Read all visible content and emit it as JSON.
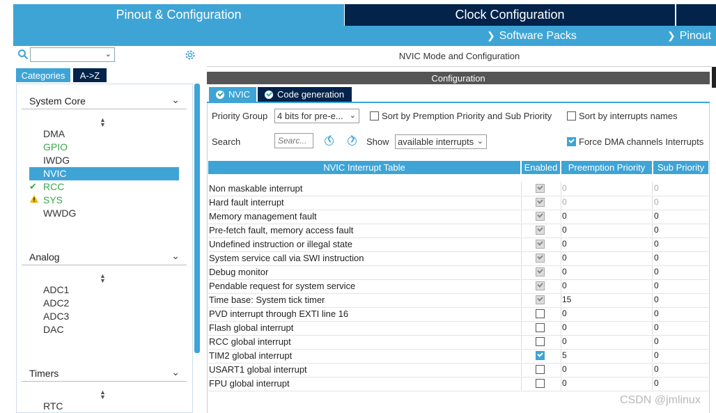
{
  "tabs": {
    "pinout": "Pinout & Configuration",
    "clock": "Clock Configuration"
  },
  "menubar": {
    "software_packs": "Software Packs",
    "pinout": "Pinout"
  },
  "left": {
    "categories_btn": "Categories",
    "az_btn": "A->Z",
    "sections": [
      {
        "label": "System Core",
        "items": [
          "DMA",
          "GPIO",
          "IWDG",
          "NVIC",
          "RCC",
          "SYS",
          "WWDG"
        ]
      },
      {
        "label": "Analog",
        "items": [
          "ADC1",
          "ADC2",
          "ADC3",
          "DAC"
        ]
      },
      {
        "label": "Timers",
        "items": [
          "RTC"
        ]
      }
    ]
  },
  "right": {
    "header": "NVIC Mode and Configuration",
    "config_bar": "Configuration",
    "subtabs": {
      "nvic": "NVIC",
      "code": "Code generation"
    },
    "priority_group_label": "Priority Group",
    "priority_group_value": "4 bits for pre-e...",
    "sort_premption_label": "Sort by Premption Priority and Sub Priority",
    "sort_names_label": "Sort by interrupts names",
    "search_label": "Search",
    "search_placeholder": "Searc...",
    "show_label": "Show",
    "show_value": "available interrupts",
    "force_dma_label": "Force DMA channels Interrupts"
  },
  "table": {
    "headers": [
      "NVIC Interrupt Table",
      "Enabled",
      "Preemption Priority",
      "Sub Priority"
    ],
    "rows": [
      {
        "name": "Non maskable interrupt",
        "pp": "0",
        "sp": "0"
      },
      {
        "name": "Hard fault interrupt",
        "pp": "0",
        "sp": "0"
      },
      {
        "name": "Memory management fault",
        "pp": "0",
        "sp": "0"
      },
      {
        "name": "Pre-fetch fault, memory access fault",
        "pp": "0",
        "sp": "0"
      },
      {
        "name": "Undefined instruction or illegal state",
        "pp": "0",
        "sp": "0"
      },
      {
        "name": "System service call via SWI instruction",
        "pp": "0",
        "sp": "0"
      },
      {
        "name": "Debug monitor",
        "pp": "0",
        "sp": "0"
      },
      {
        "name": "Pendable request for system service",
        "pp": "0",
        "sp": "0"
      },
      {
        "name": "Time base: System tick timer",
        "pp": "15",
        "sp": "0"
      },
      {
        "name": "PVD interrupt through EXTI line 16",
        "pp": "0",
        "sp": "0"
      },
      {
        "name": "Flash global interrupt",
        "pp": "0",
        "sp": "0"
      },
      {
        "name": "RCC global interrupt",
        "pp": "0",
        "sp": "0"
      },
      {
        "name": "TIM2 global interrupt",
        "pp": "5",
        "sp": "0"
      },
      {
        "name": "USART1 global interrupt",
        "pp": "0",
        "sp": "0"
      },
      {
        "name": "FPU global interrupt",
        "pp": "0",
        "sp": "0"
      }
    ]
  },
  "watermark": "CSDN @jmlinux",
  "colors": {
    "accent": "#3ea4d6",
    "dark": "#03234b",
    "green": "#3aa64a",
    "warn": "#f0b400"
  }
}
